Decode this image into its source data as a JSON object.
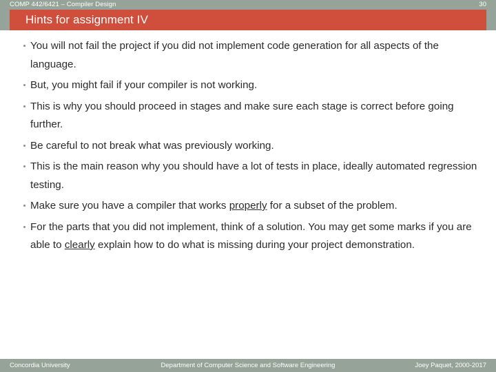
{
  "header": {
    "course": "COMP 442/6421 – Compiler Design",
    "page_number": "30"
  },
  "title": {
    "text": "Hints for assignment IV"
  },
  "colors": {
    "banner_red": "#cf4f3c",
    "band_gray_green": "#96a399",
    "body_text": "#2b2b2b",
    "slide_background": "#ffffff"
  },
  "body": {
    "bullets": [
      {
        "segments": [
          {
            "text": "You will not fail the project if you did not implement code generation for all aspects of the language.",
            "underline": false
          }
        ]
      },
      {
        "segments": [
          {
            "text": "But, you might fail if your compiler is not working.",
            "underline": false
          }
        ]
      },
      {
        "segments": [
          {
            "text": "This is why you should proceed in stages and make sure each stage is correct before going further.",
            "underline": false
          }
        ]
      },
      {
        "segments": [
          {
            "text": "Be careful to not break what was previously working.",
            "underline": false
          }
        ]
      },
      {
        "segments": [
          {
            "text": "This is the main reason why you should have a lot of tests in place, ideally automated regression testing.",
            "underline": false
          }
        ]
      },
      {
        "segments": [
          {
            "text": "Make sure you have a compiler that works ",
            "underline": false
          },
          {
            "text": "properly",
            "underline": true
          },
          {
            "text": " for a subset of the problem.",
            "underline": false
          }
        ]
      },
      {
        "segments": [
          {
            "text": "For the parts that you did not implement, think of a solution. You may get some marks if you are able to ",
            "underline": false
          },
          {
            "text": "clearly",
            "underline": true
          },
          {
            "text": " explain how to do what is missing during your project demonstration.",
            "underline": false
          }
        ]
      }
    ]
  },
  "footer": {
    "left": "Concordia University",
    "center": "Department of Computer Science and Software Engineering",
    "right": "Joey Paquet, 2000-2017"
  }
}
